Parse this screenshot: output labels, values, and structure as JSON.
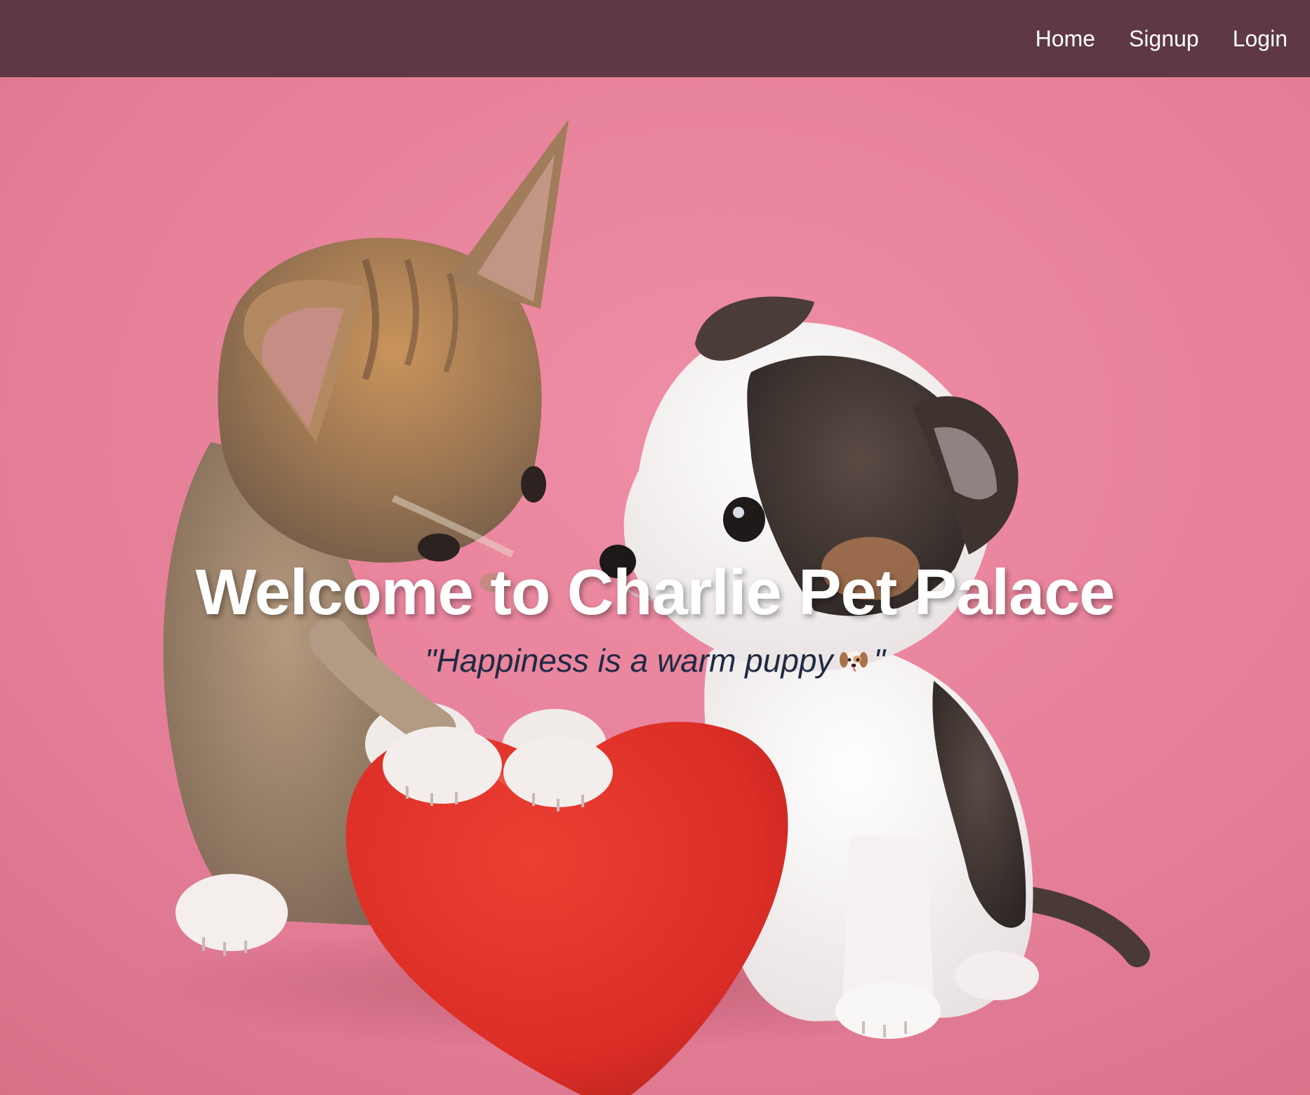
{
  "nav": {
    "home": "Home",
    "signup": "Signup",
    "login": "Login"
  },
  "hero": {
    "title": "Welcome to Charlie Pet Palace",
    "quote_open": "\"Happiness is a warm puppy",
    "quote_close": "\"",
    "quote_icon": "dog-face-icon"
  },
  "colors": {
    "navbar": "#5e3844",
    "background": "#e27a92",
    "heart": "#e03229",
    "quote_text": "#1f2a44"
  }
}
